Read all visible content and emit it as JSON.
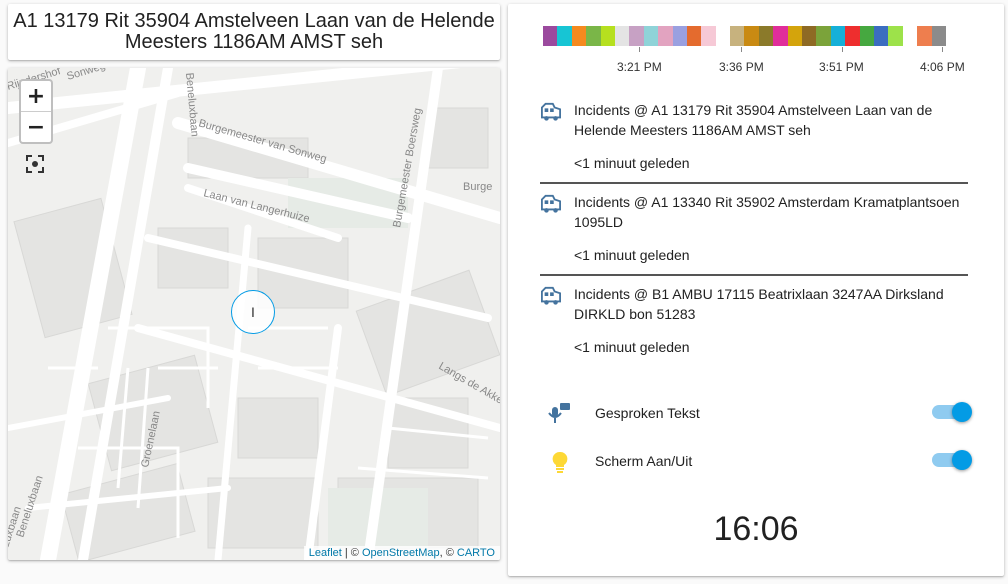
{
  "title": "A1 13179 Rit 35904 Amstelveen Laan van de Helende Meesters 1186AM AMST seh",
  "map": {
    "zoom_in": "+",
    "zoom_out": "−",
    "marker_label": "I",
    "streets": [
      "Rijndershof",
      "Sonweg",
      "Beneluxbaan",
      "Burgemeester van Sonweg",
      "Burgemeester Boersweg",
      "Burge",
      "Laan van Langerhuize",
      "Langs de Akke",
      "Groenelaan",
      "Beneluxbaan",
      "Luxbaan"
    ],
    "attribution": {
      "leaflet": "Leaflet",
      "sep1": " | © ",
      "osm": "OpenStreetMap",
      "sep2": ", © ",
      "carto": "CARTO"
    }
  },
  "timeline": {
    "ticks": [
      "3:21 PM",
      "3:36 PM",
      "3:51 PM",
      "4:06 PM"
    ],
    "segments": [
      "#9b4a9e",
      "#17c5d4",
      "#f58a1f",
      "#7ab648",
      "#b6e01f",
      "#e4e4e4",
      "#c7a1c4",
      "#8fd3d8",
      "#e2a3c0",
      "#9aa0e0",
      "#e46b2e",
      "#f6c9d6",
      "#ffffff",
      "#c7b27e",
      "#c98a12",
      "#8b7a2a",
      "#e02e9a",
      "#d4a40c",
      "#8e6a24",
      "#7ba33a",
      "#16b0d8",
      "#ee2e2e",
      "#46a840",
      "#3b6dc0",
      "#9de24a",
      "#ffffff",
      "#ee7e4e",
      "#8b8b8b"
    ]
  },
  "incidents": [
    {
      "text": "Incidents @ A1 13179 Rit 35904 Amstelveen Laan van de Helende Meesters 1186AM AMST seh",
      "time": "<1 minuut geleden",
      "icon": "ambulance-icon"
    },
    {
      "text": "Incidents @ A1 13340 Rit 35902 Amsterdam Kramatplantsoen 1095LD",
      "time": "<1 minuut geleden",
      "icon": "ambulance-icon"
    },
    {
      "text": "Incidents @ B1 AMBU 17115 Beatrixlaan 3247AA Dirksland DIRKLD bon 51283",
      "time": "<1 minuut geleden",
      "icon": "ambulance-icon"
    }
  ],
  "toggles": [
    {
      "label": "Gesproken Tekst",
      "icon": "voice-icon",
      "on": true
    },
    {
      "label": "Scherm Aan/Uit",
      "icon": "lightbulb-icon",
      "on": true
    }
  ],
  "clock": "16:06",
  "colors": {
    "accent": "#039be5",
    "icon_blue": "#44739e",
    "bulb": "#fdd835"
  }
}
